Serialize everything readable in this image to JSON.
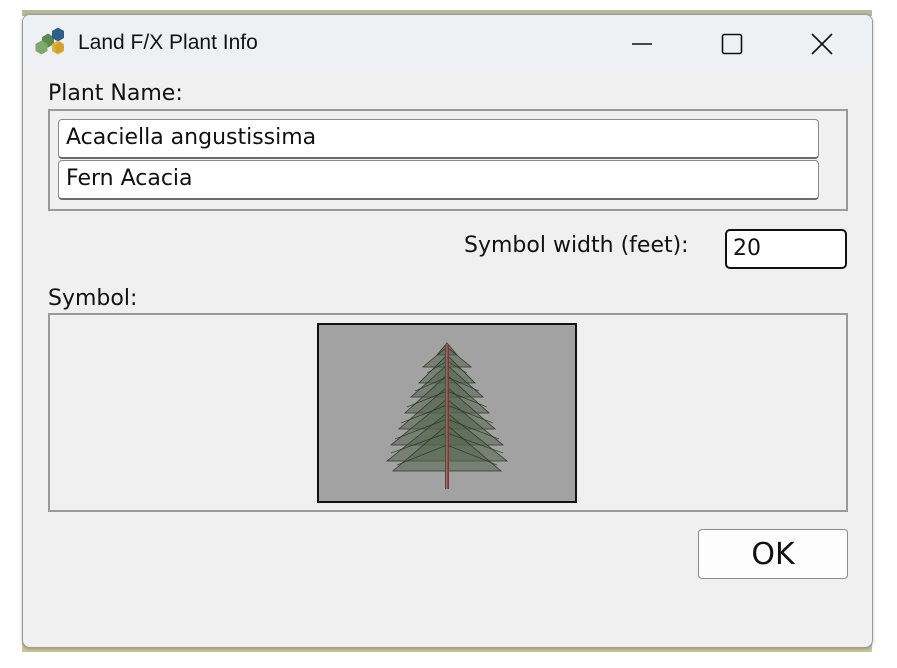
{
  "window": {
    "title": "Land F/X Plant Info",
    "icon": "land-fx-hexagon-logo-icon",
    "controls": {
      "minimize_icon": "minimize-icon",
      "maximize_icon": "maximize-icon",
      "close_icon": "close-icon"
    }
  },
  "plant_name": {
    "label": "Plant Name:",
    "botanical_name": "Acaciella angustissima",
    "common_name": "Fern Acacia"
  },
  "symbol_width": {
    "label": "Symbol width (feet):",
    "value": "20"
  },
  "symbol": {
    "label": "Symbol:",
    "preview_icon": "evergreen-tree-icon",
    "preview_background": "#a2a2a2"
  },
  "actions": {
    "ok_label": "OK"
  },
  "colors": {
    "dialog_background": "#f0f0f0",
    "titlebar_background": "#eef0f4",
    "focus_border": "#111111"
  }
}
